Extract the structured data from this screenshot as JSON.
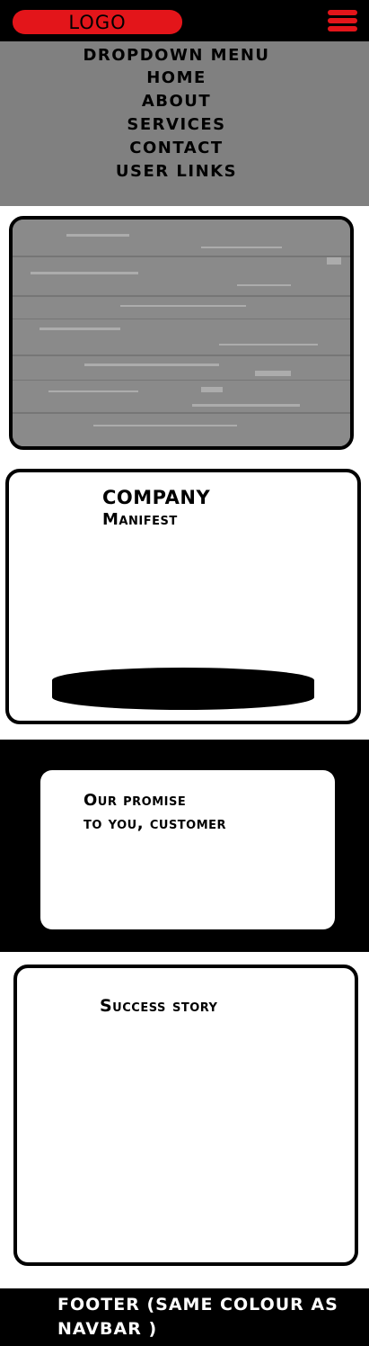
{
  "navbar": {
    "logo_label": "LOGO",
    "menu_icon": "hamburger-menu-icon",
    "background": "#000000",
    "accent": "#e3151a"
  },
  "dropdown": {
    "background": "#808080",
    "items": [
      "DROPDOWN MENU",
      "HOME",
      "ABOUT",
      "SERVICES",
      "CONTACT",
      "USER LINKS"
    ]
  },
  "hero": {
    "image": "grey-texture-placeholder-image"
  },
  "manifest": {
    "title": "COMPANY",
    "subtitle": "Manifest"
  },
  "promise": {
    "line1": "Our promise",
    "line2": "to you, customer"
  },
  "story": {
    "title": "Success story"
  },
  "footer": {
    "text": "FOOTER (SAME COLOUR AS NAVBAR )",
    "background": "#000000"
  }
}
